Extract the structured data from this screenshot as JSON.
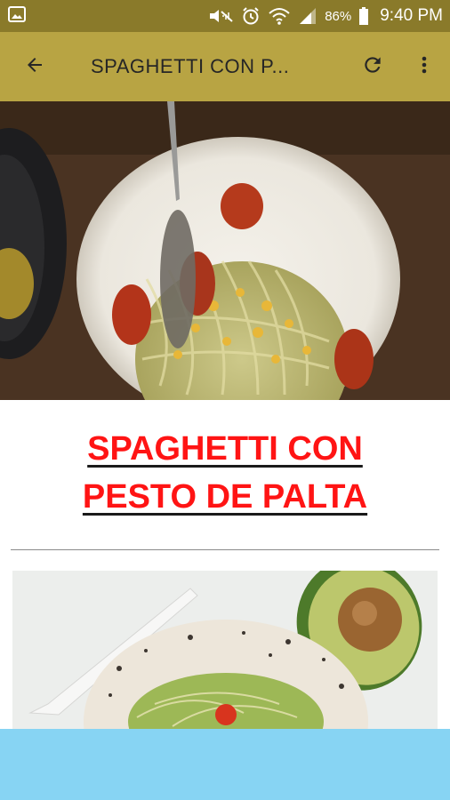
{
  "status_bar": {
    "battery_percent": "86%",
    "time": "9:40 PM"
  },
  "app_bar": {
    "title": "SPAGHETTI CON P..."
  },
  "recipe": {
    "title_line1": "SPAGHETTI CON",
    "title_line2": "PESTO DE PALTA"
  },
  "colors": {
    "status_bar": "#8a7a2a",
    "app_bar": "#b8a443",
    "title_red": "#ff1414",
    "bottom_bar": "#87d4f3"
  },
  "icons": [
    "image-icon",
    "mute-icon",
    "alarm-icon",
    "wifi-icon",
    "signal-icon",
    "battery-icon",
    "back-arrow-icon",
    "refresh-icon",
    "more-vert-icon"
  ]
}
